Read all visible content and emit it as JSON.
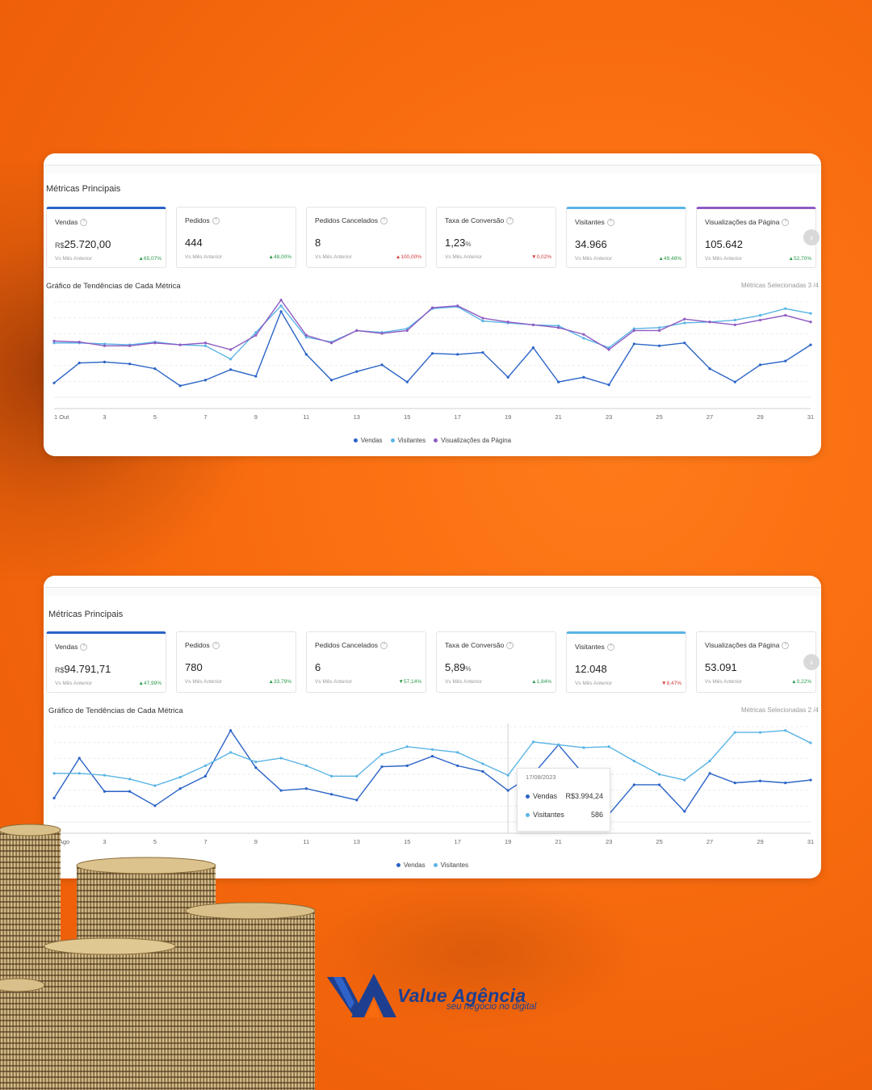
{
  "colors": {
    "background": "#f86c0f",
    "vendas": "#2a63c7",
    "visitantes": "#5ab4e6",
    "visualizacoes": "#8e5bc2",
    "up": "#2a9a4a",
    "down": "#d23a3a",
    "brand": "#1e3f8f"
  },
  "panel1": {
    "title": "Métricas Principais",
    "cards": [
      {
        "label": "Vendas",
        "currency": "R$",
        "value": "25.720,00",
        "unit": "",
        "sub": "Vs Mês Anterior",
        "delta": "65,07%",
        "dir": "up",
        "accent": "blue"
      },
      {
        "label": "Pedidos",
        "currency": "",
        "value": "444",
        "unit": "",
        "sub": "Vs Mês Anterior",
        "delta": "48,00%",
        "dir": "up",
        "accent": ""
      },
      {
        "label": "Pedidos Cancelados",
        "currency": "",
        "value": "8",
        "unit": "",
        "sub": "Vs Mês Anterior",
        "delta": "100,00%",
        "dir": "up-red",
        "accent": ""
      },
      {
        "label": "Taxa de Conversão",
        "currency": "",
        "value": "1,23",
        "unit": "%",
        "sub": "Vs Mês Anterior",
        "delta": "0,02%",
        "dir": "down",
        "accent": ""
      },
      {
        "label": "Visitantes",
        "currency": "",
        "value": "34.966",
        "unit": "",
        "sub": "Vs Mês Anterior",
        "delta": "49,48%",
        "dir": "up",
        "accent": "light"
      },
      {
        "label": "Visualizações da Página",
        "currency": "",
        "value": "105.642",
        "unit": "",
        "sub": "Vs Mês Anterior",
        "delta": "52,70%",
        "dir": "up",
        "accent": "purple"
      }
    ],
    "chart_title": "Gráfico de Tendências de Cada Métrica",
    "selected": "Métricas Selecionadas 3 /4",
    "legend": [
      "Vendas",
      "Visitantes",
      "Visualizações da Página"
    ]
  },
  "panel2": {
    "title": "Métricas Principais",
    "cards": [
      {
        "label": "Vendas",
        "currency": "R$",
        "value": "94.791,71",
        "unit": "",
        "sub": "Vs Mês Anterior",
        "delta": "47,99%",
        "dir": "up",
        "accent": "blue"
      },
      {
        "label": "Pedidos",
        "currency": "",
        "value": "780",
        "unit": "",
        "sub": "Vs Mês Anterior",
        "delta": "33,79%",
        "dir": "up",
        "accent": ""
      },
      {
        "label": "Pedidos Cancelados",
        "currency": "",
        "value": "6",
        "unit": "",
        "sub": "Vs Mês Anterior",
        "delta": "57,14%",
        "dir": "down-green",
        "accent": ""
      },
      {
        "label": "Taxa de Conversão",
        "currency": "",
        "value": "5,89",
        "unit": "%",
        "sub": "Vs Mês Anterior",
        "delta": "1,84%",
        "dir": "up",
        "accent": ""
      },
      {
        "label": "Visitantes",
        "currency": "",
        "value": "12.048",
        "unit": "",
        "sub": "Vs Mês Anterior",
        "delta": "8,47%",
        "dir": "down",
        "accent": "light"
      },
      {
        "label": "Visualizações da Página",
        "currency": "",
        "value": "53.091",
        "unit": "",
        "sub": "Vs Mês Anterior",
        "delta": "0,22%",
        "dir": "up",
        "accent": ""
      }
    ],
    "chart_title": "Gráfico de Tendências de Cada Métrica",
    "selected": "Métricas Selecionadas 2 /4",
    "legend": [
      "Vendas",
      "Visitantes"
    ],
    "tooltip": {
      "date": "17/08/2023",
      "rows": [
        {
          "name": "Vendas",
          "value": "R$3.994,24"
        },
        {
          "name": "Visitantes",
          "value": "586"
        }
      ]
    }
  },
  "chart_data": [
    {
      "type": "line",
      "title": "Gráfico de Tendências de Cada Métrica",
      "x": [
        1,
        2,
        3,
        4,
        5,
        6,
        7,
        8,
        9,
        10,
        11,
        12,
        13,
        14,
        15,
        16,
        17,
        18,
        19,
        20,
        21,
        22,
        23,
        24,
        25,
        26,
        27,
        28,
        29,
        30,
        31
      ],
      "x_tick_labels": [
        "1 Out",
        "3",
        "5",
        "7",
        "9",
        "11",
        "13",
        "15",
        "17",
        "19",
        "21",
        "23",
        "25",
        "27",
        "29",
        "31"
      ],
      "ylim": [
        0,
        100
      ],
      "grid": true,
      "legend_placement": "bottom",
      "series": [
        {
          "name": "Vendas",
          "values": [
            15,
            36,
            37,
            35,
            30,
            12,
            18,
            29,
            22,
            90,
            45,
            18,
            27,
            34,
            16,
            46,
            45,
            47,
            21,
            52,
            16,
            21,
            13,
            56,
            54,
            57,
            30,
            16,
            34,
            38,
            55
          ]
        },
        {
          "name": "Visitantes",
          "values": [
            57,
            57,
            56,
            55,
            58,
            55,
            54,
            40,
            68,
            96,
            63,
            58,
            70,
            68,
            72,
            93,
            95,
            80,
            78,
            76,
            75,
            62,
            52,
            72,
            73,
            78,
            79,
            81,
            86,
            93,
            88
          ]
        },
        {
          "name": "Visualizações da Página",
          "values": [
            59,
            58,
            54,
            54,
            57,
            55,
            57,
            50,
            65,
            102,
            65,
            57,
            70,
            67,
            70,
            94,
            96,
            83,
            79,
            76,
            73,
            66,
            50,
            70,
            70,
            82,
            79,
            76,
            81,
            86,
            79
          ]
        }
      ]
    },
    {
      "type": "line",
      "title": "Gráfico de Tendências de Cada Métrica",
      "x": [
        1,
        2,
        3,
        4,
        5,
        6,
        7,
        8,
        9,
        10,
        11,
        12,
        13,
        14,
        15,
        16,
        17,
        18,
        19,
        20,
        21,
        22,
        23,
        24,
        25,
        26,
        27,
        28,
        29,
        30,
        31
      ],
      "x_tick_labels": [
        "1 Ago",
        "3",
        "5",
        "7",
        "9",
        "11",
        "13",
        "15",
        "17",
        "19",
        "21",
        "23",
        "25",
        "27",
        "29",
        "31"
      ],
      "ylim": [
        0,
        100
      ],
      "grid": true,
      "legend_placement": "bottom",
      "series": [
        {
          "name": "Vendas",
          "values": [
            25,
            67,
            32,
            32,
            17,
            35,
            48,
            96,
            57,
            33,
            35,
            29,
            23,
            58,
            59,
            69,
            59,
            53,
            33,
            50,
            81,
            50,
            8,
            39,
            39,
            11,
            51,
            41,
            43,
            41,
            44
          ]
        },
        {
          "name": "Visitantes",
          "values": [
            51,
            51,
            49,
            45,
            38,
            47,
            59,
            73,
            63,
            67,
            59,
            48,
            48,
            71,
            79,
            76,
            73,
            61,
            49,
            84,
            81,
            78,
            79,
            64,
            50,
            44,
            64,
            94,
            94,
            96,
            83
          ]
        }
      ]
    }
  ]
}
